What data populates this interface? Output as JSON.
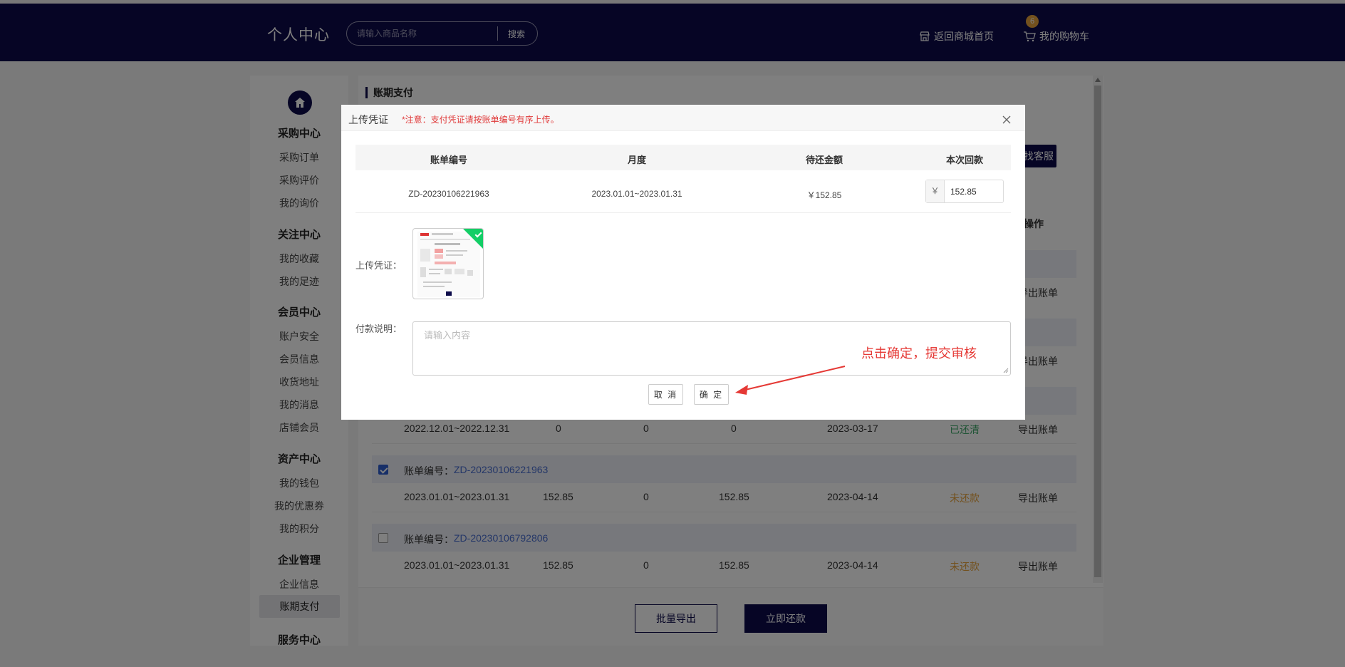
{
  "header": {
    "title": "个人中心",
    "search_placeholder": "请输入商品名称",
    "search_button": "搜索",
    "home_link": "返回商城首页",
    "cart_link": "我的购物车",
    "cart_count": "6"
  },
  "sidebar": {
    "groups": [
      {
        "title": "采购中心",
        "items": [
          "采购订单",
          "采购评价",
          "我的询价"
        ]
      },
      {
        "title": "关注中心",
        "items": [
          "我的收藏",
          "我的足迹"
        ]
      },
      {
        "title": "会员中心",
        "items": [
          "账户安全",
          "会员信息",
          "收货地址",
          "我的消息",
          "店铺会员"
        ]
      },
      {
        "title": "资产中心",
        "items": [
          "我的钱包",
          "我的优惠券",
          "我的积分"
        ]
      },
      {
        "title": "企业管理",
        "items": [
          "企业信息",
          "账期支付"
        ]
      },
      {
        "title": "服务中心",
        "items": []
      }
    ],
    "active_item": "账期支付"
  },
  "main": {
    "section_title": "账期支付",
    "kefu_button": "找客服",
    "op_header": "操作",
    "export_link": "导出账单",
    "bill_prefix": "账单编号：",
    "rows": [
      {
        "period": "2022.12.01~2022.12.31",
        "amount": "0",
        "paid": "0",
        "remain": "0",
        "due": "2023-03-17",
        "status": "已还清",
        "status_type": "green"
      },
      {
        "bill_no": "ZD-20230106221963",
        "checked": true,
        "period": "2023.01.01~2023.01.31",
        "amount": "152.85",
        "paid": "0",
        "remain": "152.85",
        "due": "2023-04-14",
        "status": "未还款",
        "status_type": "orange"
      },
      {
        "bill_no": "ZD-20230106792806",
        "checked": false,
        "period": "2023.01.01~2023.01.31",
        "amount": "152.85",
        "paid": "0",
        "remain": "152.85",
        "due": "2023-04-14",
        "status": "未还款",
        "status_type": "orange"
      }
    ],
    "batch_export": "批量导出",
    "repay_now": "立即还款"
  },
  "modal": {
    "title": "上传凭证",
    "note": "*注意：支付凭证请按账单编号有序上传。",
    "columns": [
      "账单编号",
      "月度",
      "待还金额",
      "本次回款"
    ],
    "row": {
      "bill_no": "ZD-20230106221963",
      "month": "2023.01.01~2023.01.31",
      "pending": "￥152.85",
      "currency": "￥",
      "payment": "152.85"
    },
    "upload_label": "上传凭证：",
    "remark_label": "付款说明：",
    "remark_placeholder": "请输入内容",
    "cancel": "取 消",
    "confirm": "确 定"
  },
  "annotation": {
    "text": "点击确定，提交审核",
    "color": "#e53935"
  }
}
